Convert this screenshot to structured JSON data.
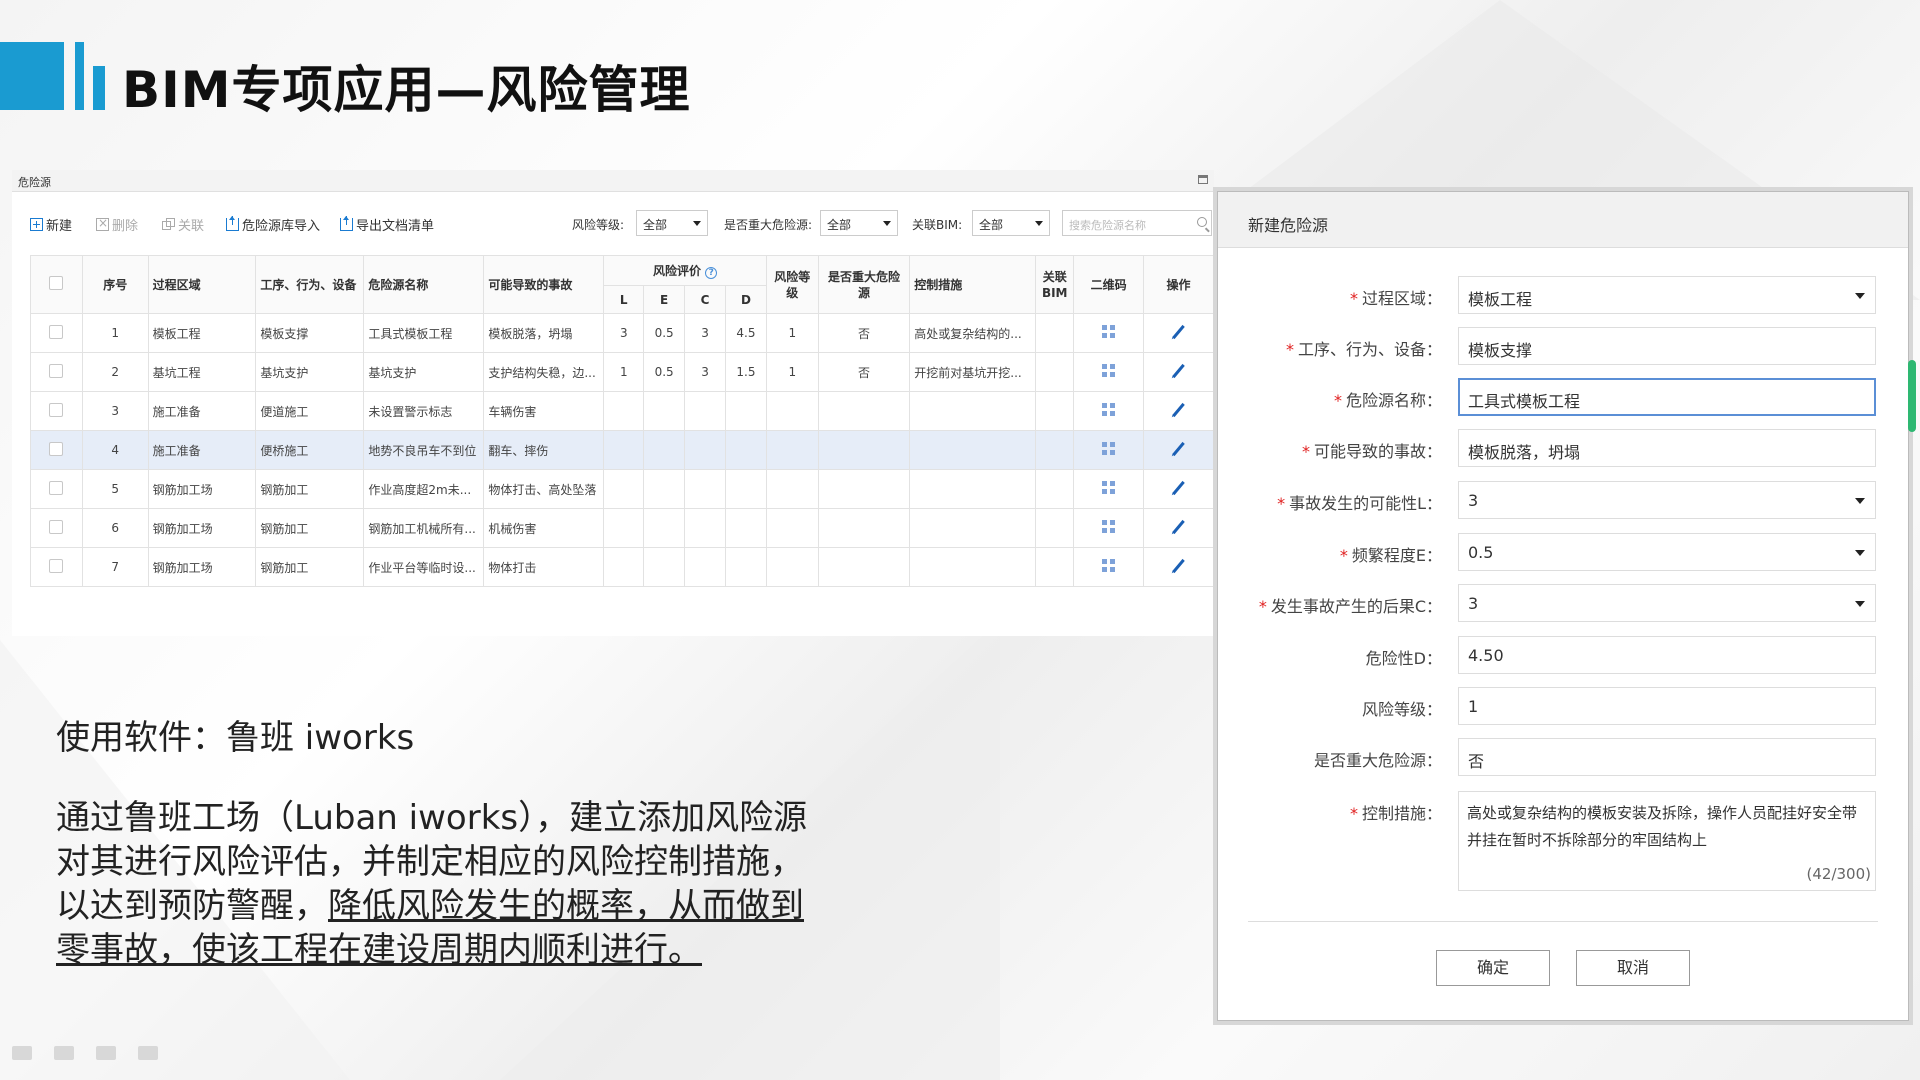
{
  "slide_title": "BIM专项应用—风险管理",
  "panel": {
    "title": "危险源",
    "toolbar": {
      "new": "新建",
      "delete": "删除",
      "link": "关联",
      "import": "危险源库导入",
      "export": "导出文档清单",
      "risk_level_label": "风险等级:",
      "risk_level_value": "全部",
      "major_label": "是否重大危险源:",
      "major_value": "全部",
      "bim_label": "关联BIM:",
      "bim_value": "全部",
      "search_placeholder": "搜索危险源名称"
    },
    "table": {
      "headers": {
        "index": "序号",
        "area": "过程区域",
        "process": "工序、行为、设备",
        "hazard": "危险源名称",
        "accident": "可能导致的事故",
        "risk_eval": "风险评价",
        "l": "L",
        "e": "E",
        "c": "C",
        "d": "D",
        "risk_level": "风险等级",
        "major": "是否重大危险源",
        "control": "控制措施",
        "bim": "关联BIM",
        "qrcode": "二维码",
        "ops": "操作"
      },
      "rows": [
        {
          "index": "1",
          "area": "模板工程",
          "process": "模板支撑",
          "hazard": "工具式模板工程",
          "accident": "模板脱落，坍塌",
          "l": "3",
          "e": "0.5",
          "c": "3",
          "d": "4.5",
          "level": "1",
          "major": "否",
          "control": "高处或复杂结构的..."
        },
        {
          "index": "2",
          "area": "基坑工程",
          "process": "基坑支护",
          "hazard": "基坑支护",
          "accident": "支护结构失稳，边...",
          "l": "1",
          "e": "0.5",
          "c": "3",
          "d": "1.5",
          "level": "1",
          "major": "否",
          "control": "开挖前对基坑开挖..."
        },
        {
          "index": "3",
          "area": "施工准备",
          "process": "便道施工",
          "hazard": "未设置警示标志",
          "accident": "车辆伤害",
          "l": "",
          "e": "",
          "c": "",
          "d": "",
          "level": "",
          "major": "",
          "control": ""
        },
        {
          "index": "4",
          "area": "施工准备",
          "process": "便桥施工",
          "hazard": "地势不良吊车不到位",
          "accident": "翻车、摔伤",
          "l": "",
          "e": "",
          "c": "",
          "d": "",
          "level": "",
          "major": "",
          "control": ""
        },
        {
          "index": "5",
          "area": "钢筋加工场",
          "process": "钢筋加工",
          "hazard": "作业高度超2m未...",
          "accident": "物体打击、高处坠落",
          "l": "",
          "e": "",
          "c": "",
          "d": "",
          "level": "",
          "major": "",
          "control": ""
        },
        {
          "index": "6",
          "area": "钢筋加工场",
          "process": "钢筋加工",
          "hazard": "钢筋加工机械所有...",
          "accident": "机械伤害",
          "l": "",
          "e": "",
          "c": "",
          "d": "",
          "level": "",
          "major": "",
          "control": ""
        },
        {
          "index": "7",
          "area": "钢筋加工场",
          "process": "钢筋加工",
          "hazard": "作业平台等临时设...",
          "accident": "物体打击",
          "l": "",
          "e": "",
          "c": "",
          "d": "",
          "level": "",
          "major": "",
          "control": ""
        }
      ]
    }
  },
  "body": {
    "software": "使用软件：鲁班 iworks",
    "desc_plain": "通过鲁班工场（Luban  iworks），建立添加风险源对其进行风险评估，并制定相应的风险控制措施，以达到预防警醒，",
    "desc_underlined": "降低风险发生的概率，从而做到零事故，使该工程在建设周期内顺利进行。"
  },
  "dialog": {
    "title": "新建危险源",
    "fields": {
      "area_label": "过程区域：",
      "area_value": "模板工程",
      "process_label": "工序、行为、设备：",
      "process_value": "模板支撑",
      "hazard_label": "危险源名称：",
      "hazard_value": "工具式模板工程",
      "accident_label": "可能导致的事故：",
      "accident_value": "模板脱落，坍塌",
      "l_label": "事故发生的可能性L：",
      "l_value": "3",
      "e_label": "频繁程度E：",
      "e_value": "0.5",
      "c_label": "发生事故产生的后果C：",
      "c_value": "3",
      "d_label": "危险性D：",
      "d_value": "4.50",
      "level_label": "风险等级：",
      "level_value": "1",
      "major_label": "是否重大危险源：",
      "major_value": "否",
      "control_label": "控制措施：",
      "control_value": "高处或复杂结构的模板安装及拆除，操作人员配挂好安全带并挂在暂时不拆除部分的牢固结构上",
      "control_counter": "(42/300)"
    },
    "confirm": "确定",
    "cancel": "取消"
  },
  "colors": {
    "accent": "#1a9bd1",
    "selected_row": "#e6edf8",
    "required": "#e02020",
    "scroll_thumb": "#2eb872"
  }
}
